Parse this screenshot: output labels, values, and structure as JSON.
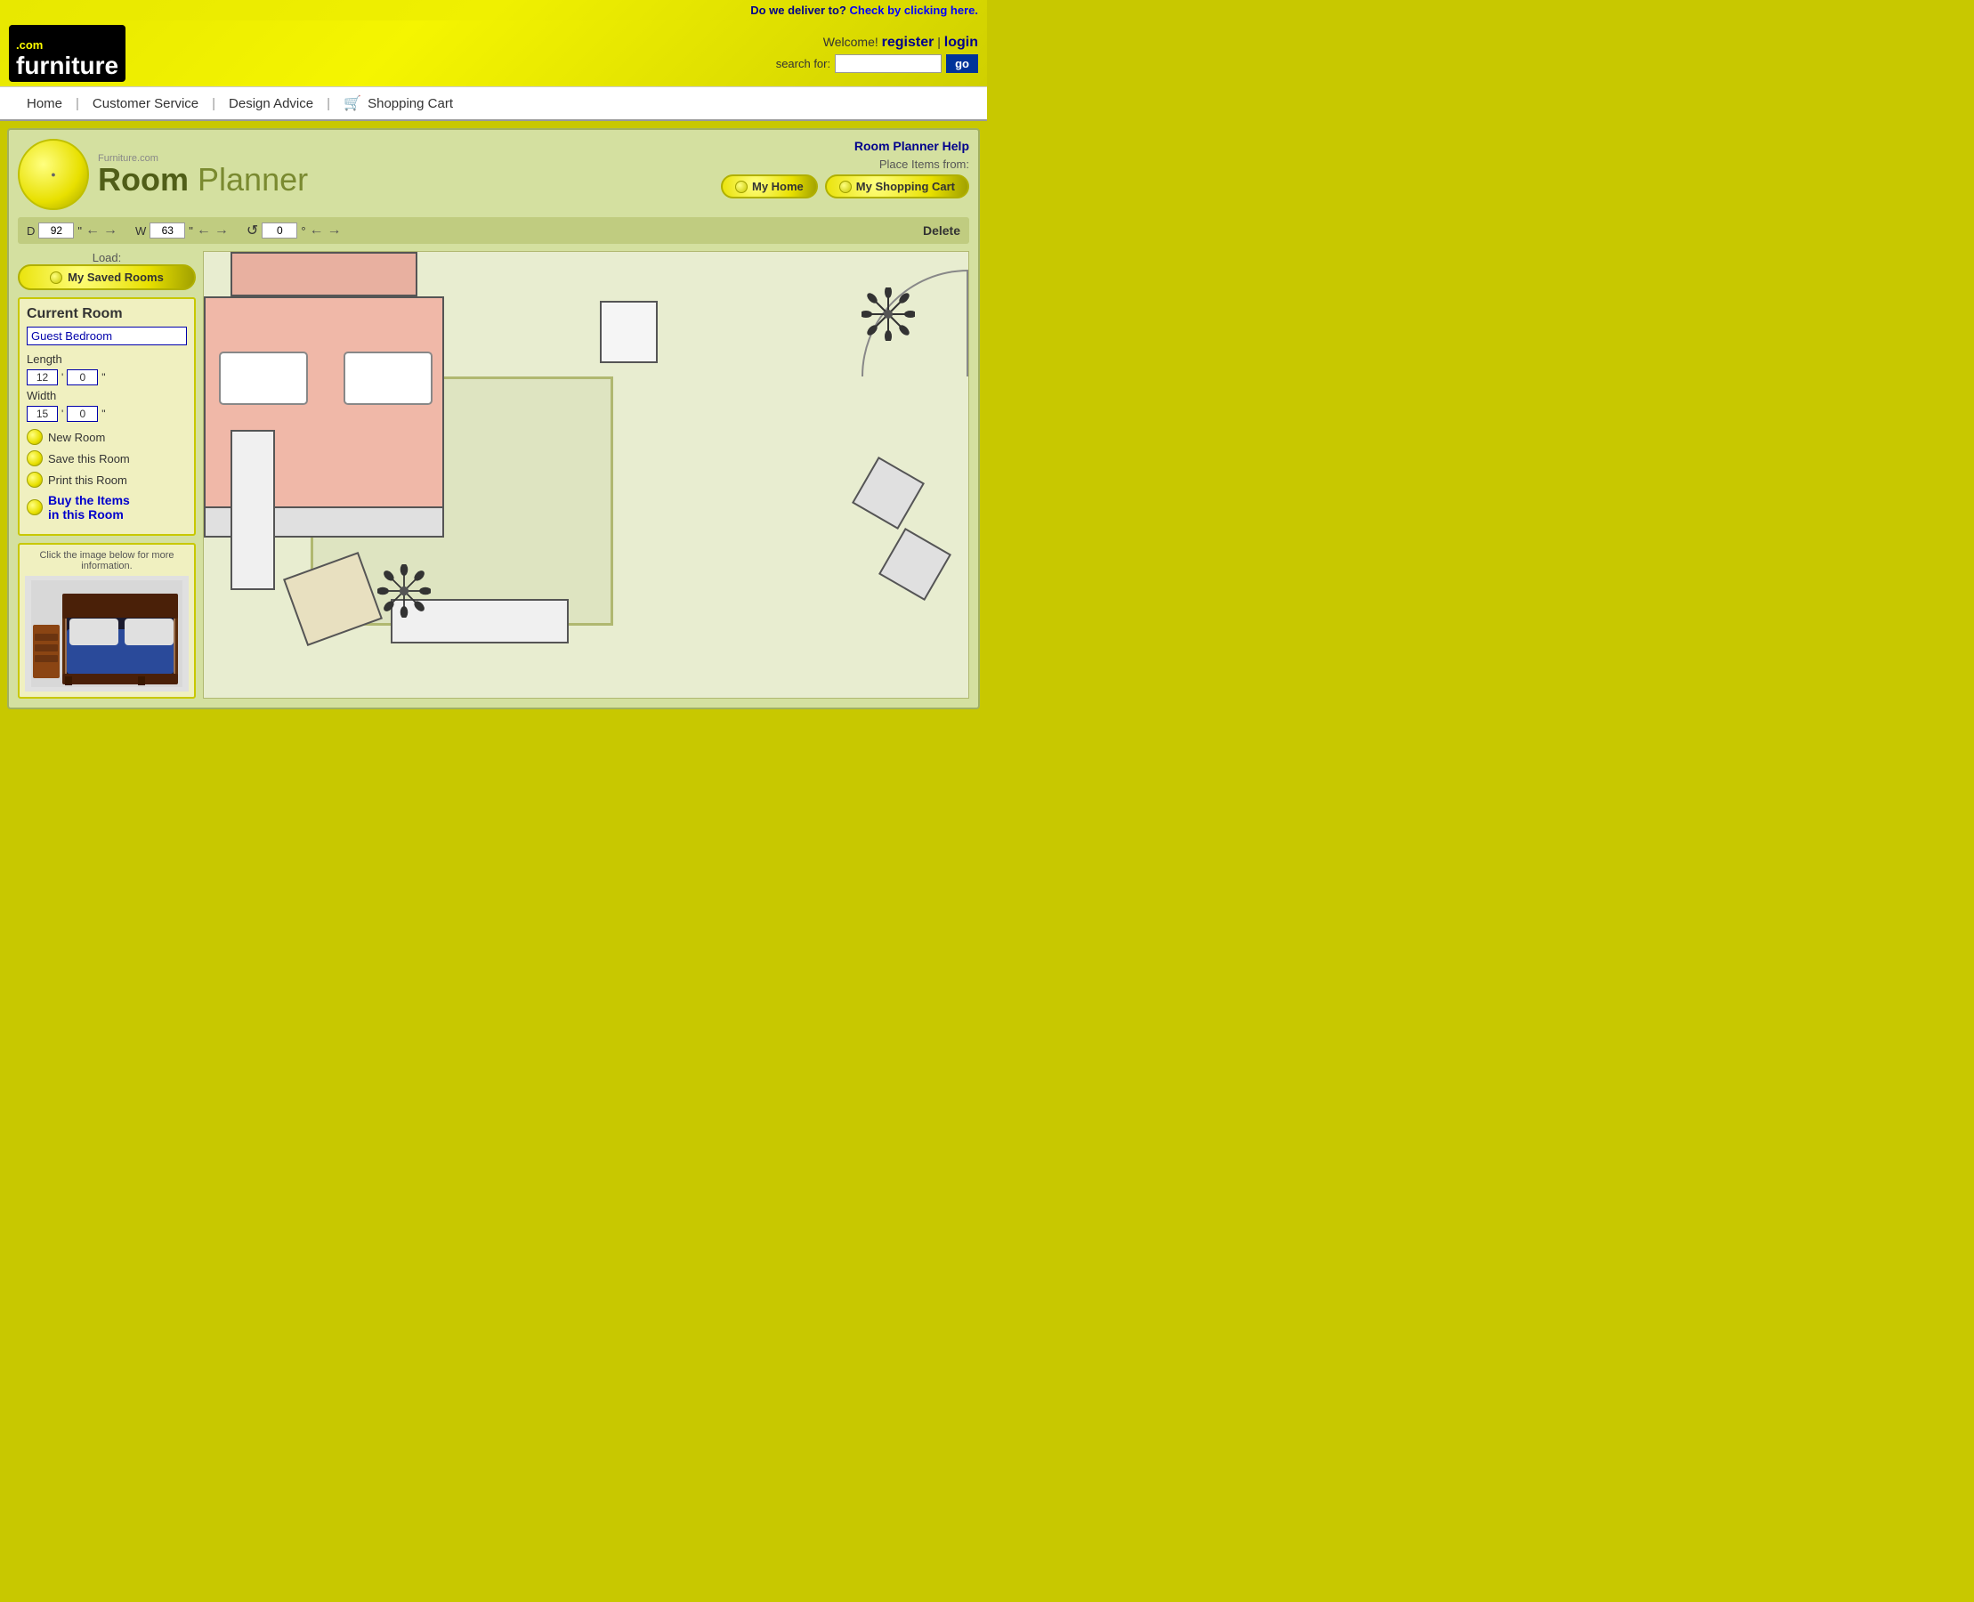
{
  "delivery": {
    "prefix": "Do we deliver to?",
    "link": "Check by clicking here."
  },
  "header": {
    "logo_top": ".com",
    "logo_main": "furniture",
    "welcome": "Welcome!",
    "register": "register",
    "pipe": "|",
    "login": "login",
    "search_label": "search for:",
    "search_placeholder": "",
    "go_btn": "go"
  },
  "navbar": {
    "home": "Home",
    "customer_service": "Customer Service",
    "design_advice": "Design Advice",
    "shopping_cart": "Shopping Cart"
  },
  "planner": {
    "help_link": "Room Planner Help",
    "place_items_label": "Place Items from:",
    "my_home_btn": "My Home",
    "my_shopping_cart_btn": "My Shopping Cart",
    "load_label": "Load:",
    "my_saved_rooms_btn": "My Saved Rooms",
    "current_room_title": "Current Room",
    "room_name": "Guest Bedroom",
    "length_label": "Length",
    "length_ft": "12",
    "length_in": "0",
    "width_label": "Width",
    "width_ft": "15",
    "width_in": "0",
    "new_room": "New Room",
    "save_room": "Save this Room",
    "print_room": "Print this Room",
    "buy_items_line1": "Buy the Items",
    "buy_items_line2": "in this Room",
    "product_hint": "Click the image below for more information.",
    "controls": {
      "d_label": "D",
      "d_value": "92",
      "d_unit": "\"",
      "w_label": "W",
      "w_value": "63",
      "w_unit": "\"",
      "rotate_value": "0",
      "rotate_unit": "°",
      "delete_label": "Delete"
    },
    "logo_com": "Furniture.com",
    "logo_room": "Room",
    "logo_planner": "Planner"
  }
}
